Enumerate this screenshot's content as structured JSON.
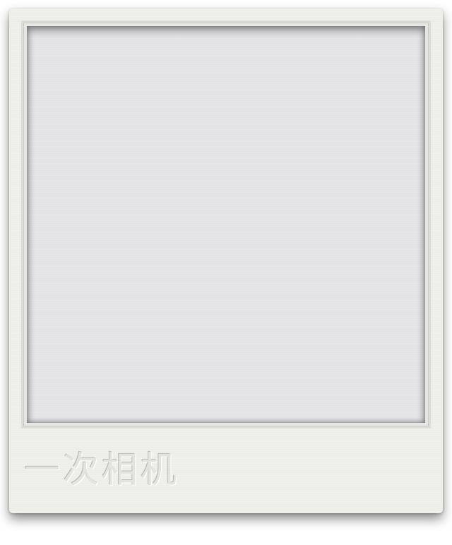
{
  "polaroid": {
    "caption": "一次相机"
  }
}
